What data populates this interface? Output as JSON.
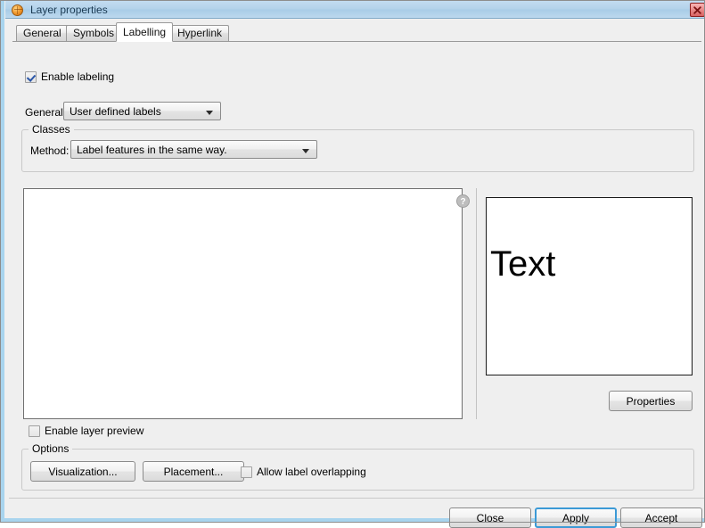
{
  "window": {
    "title": "Layer properties",
    "icon": "globe-icon",
    "close_icon": "close-icon",
    "accent_blue": "#a8d4ee",
    "titlebar_color": "#b3d2ea",
    "face_color": "#efefef"
  },
  "tabs": [
    {
      "label": "General",
      "active": false
    },
    {
      "label": "Symbols",
      "active": false
    },
    {
      "label": "Labelling",
      "active": true
    },
    {
      "label": "Hyperlink",
      "active": false
    }
  ],
  "labelling": {
    "enable_labeling": {
      "label": "Enable labeling",
      "checked": true
    },
    "general": {
      "label": "General:",
      "value": "User defined labels",
      "options": [
        "User defined labels"
      ]
    },
    "classes_group": {
      "title": "Classes",
      "method": {
        "label": "Method:",
        "value": "Label features in the same way.",
        "options": [
          "Label features in the same way."
        ]
      }
    },
    "content_panel": {
      "help_icon": "help-circle-icon"
    },
    "preview": {
      "sample_text": "Text",
      "properties_button": "Properties"
    },
    "enable_layer_preview": {
      "label": "Enable layer preview",
      "checked": false
    },
    "options_group": {
      "title": "Options",
      "visualization_button": "Visualization...",
      "placement_button": "Placement...",
      "allow_overlapping": {
        "label": "Allow label overlapping",
        "checked": false
      }
    }
  },
  "footer": {
    "close_button": "Close",
    "apply_button": "Apply",
    "accept_button": "Accept",
    "focused_button": "Apply"
  }
}
